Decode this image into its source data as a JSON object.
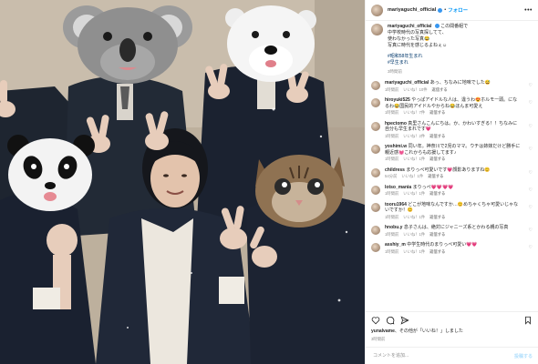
{
  "header": {
    "username": "mariyaguchi_official",
    "separator": "•",
    "follow_label": "フォロー",
    "more_icon": "more-horizontal-icon"
  },
  "caption": {
    "username": "mariyaguchi_official",
    "lines": [
      "この間番組で",
      "中学校時代の写真探してて、",
      "使わなかった写真😂",
      "写真に時代を感じるよねぇ☺︎"
    ],
    "hashtags": [
      "#昭和58年生まれ",
      "#早生まれ"
    ],
    "time": "3時間前"
  },
  "comments": [
    {
      "username": "mariyaguchi_official",
      "text": "あっ、ちなみに地味でした😅",
      "time": "1時間前",
      "likes": "いいね！10件",
      "reply": "返信する"
    },
    {
      "username": "hiroyuki525",
      "text": "やっぱアイドルな人は、違うわ😍ホルモー頭。になるわ😂国民的アイドルやからね😂ほんま可愛え",
      "time": "1時間前",
      "likes": "いいね！7件",
      "reply": "返信する"
    },
    {
      "username": "hpectomo",
      "text": "真里さんこんにちは。か、かわいすぎる！！ちなみに自分も早生まれです💗",
      "time": "1時間前",
      "likes": "いいね！2件",
      "reply": "返信する"
    },
    {
      "username": "yoshimi.w",
      "text": "同い年。神奈川で2児のママ。ウチは姉妹だけど勝手に親近感💓これからも応援してます♪",
      "time": "1時間前",
      "likes": "いいね！1件",
      "reply": "返信する"
    },
    {
      "username": "childress",
      "text": "まりっぺ可愛いです💗顔影ありますね😊",
      "time": "54分前",
      "likes": "いいね！1件",
      "reply": "返信する"
    },
    {
      "username": "lotso_mania",
      "text": "まりっぺ💗💗💗💗",
      "time": "1時間前",
      "likes": "いいね！1件",
      "reply": "返信する"
    },
    {
      "username": "tooru1964",
      "text": "どこが地味なんですか…😊めちゃくちゃ可愛いじゃないですか！😊",
      "time": "1時間前",
      "likes": "いいね！1件",
      "reply": "返信する"
    },
    {
      "username": "hnobu.y",
      "text": "息子さんは、絶対にジャニーズ系とかわる親の写真",
      "time": "1時間前",
      "likes": "いいね！1件",
      "reply": "返信する"
    },
    {
      "username": "asshiy_m",
      "text": "中学生時代のまりっぺ可愛い💗💗",
      "time": "1時間前",
      "likes": "いいね！1件",
      "reply": "返信する"
    }
  ],
  "actions": {
    "like_icon": "heart-outline-icon",
    "comment_icon": "comment-bubble-icon",
    "share_icon": "paper-plane-icon",
    "save_icon": "bookmark-icon"
  },
  "likes_line": {
    "username": "yunalvame",
    "suffix": "、その他が「いいね！」しました"
  },
  "posted_time": "3時間前",
  "add_comment": {
    "placeholder": "コメントを追加...",
    "post_label": "投稿する"
  },
  "photo": {
    "description_labels": [],
    "mask_icons": [
      "koala-mask-icon",
      "polar-bear-mask-icon",
      "panda-mask-icon",
      "cat-mask-icon"
    ]
  }
}
